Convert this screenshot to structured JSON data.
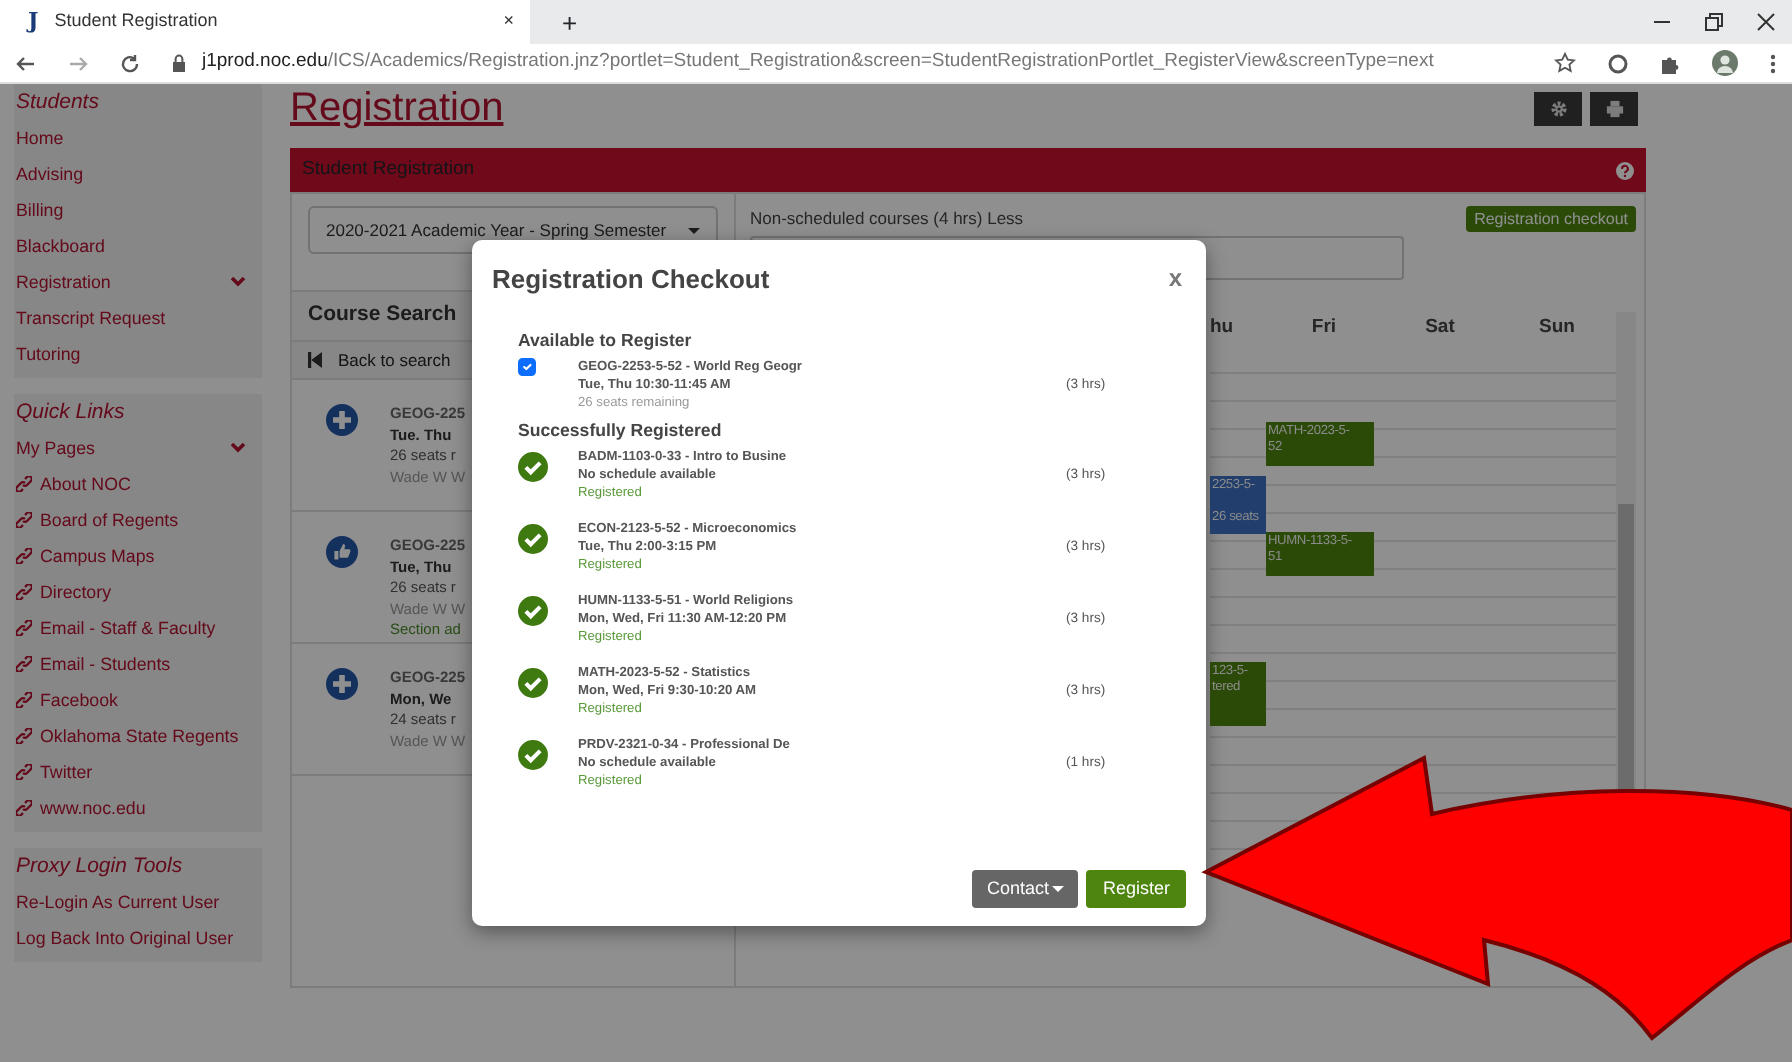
{
  "browser": {
    "tab": {
      "favicon": "J",
      "title": "Student Registration",
      "close": "×"
    },
    "new_tab": "+",
    "address": {
      "host": "j1prod.noc.edu",
      "path": "/ICS/Academics/Registration.jnz?portlet=Student_Registration&screen=StudentRegistrationPortlet_RegisterView&screenType=next"
    }
  },
  "sidebar": [
    {
      "title": "Students",
      "items": [
        {
          "label": "Home",
          "kind": "plain"
        },
        {
          "label": "Advising",
          "kind": "plain"
        },
        {
          "label": "Billing",
          "kind": "plain"
        },
        {
          "label": "Blackboard",
          "kind": "plain"
        },
        {
          "label": "Registration",
          "kind": "menu"
        },
        {
          "label": "Transcript Request",
          "kind": "plain"
        },
        {
          "label": "Tutoring",
          "kind": "plain"
        }
      ]
    },
    {
      "title": "Quick Links",
      "items": [
        {
          "label": "My Pages",
          "kind": "menu"
        },
        {
          "label": "About NOC",
          "kind": "link"
        },
        {
          "label": "Board of Regents",
          "kind": "link"
        },
        {
          "label": "Campus Maps",
          "kind": "link"
        },
        {
          "label": "Directory",
          "kind": "link"
        },
        {
          "label": "Email - Staff & Faculty",
          "kind": "link"
        },
        {
          "label": "Email - Students",
          "kind": "link"
        },
        {
          "label": "Facebook",
          "kind": "link"
        },
        {
          "label": "Oklahoma State Regents",
          "kind": "link"
        },
        {
          "label": "Twitter",
          "kind": "link"
        },
        {
          "label": "www.noc.edu",
          "kind": "link"
        }
      ]
    },
    {
      "title": "Proxy Login Tools",
      "items": [
        {
          "label": "Re-Login As Current User",
          "kind": "plain"
        },
        {
          "label": "Log Back Into Original User",
          "kind": "plain"
        }
      ]
    }
  ],
  "page": {
    "heading": "Registration",
    "portlet_title": "Student Registration",
    "term_select": "2020-2021 Academic Year - Spring Semester",
    "course_search": {
      "title": "Course Search",
      "back_link": "Back to search",
      "courses": [
        {
          "kind": "add",
          "code": "GEOG-225",
          "schedule": "Tue. Thu",
          "seats": "26 seats r",
          "instructor": "Wade W W"
        },
        {
          "kind": "added",
          "code": "GEOG-225",
          "schedule": "Tue, Thu",
          "seats": "26 seats r",
          "instructor": "Wade W W",
          "status": "Section ad"
        },
        {
          "kind": "add",
          "code": "GEOG-225",
          "schedule": "Mon, We",
          "seats": "24 seats r",
          "instructor": "Wade W W"
        }
      ]
    },
    "non_scheduled": {
      "label": "Non-scheduled courses (4 hrs)",
      "toggle": "Less"
    },
    "checkout_button": "Registration checkout",
    "calendar": {
      "days": [
        "hu",
        "Fri",
        "Sat",
        "Sun"
      ],
      "events": [
        {
          "lines": [
            "MATH-2023-5-",
            "52"
          ],
          "color": "#2b4a08"
        },
        {
          "lines": [
            "2253-5-",
            "26 seats"
          ],
          "color": "#213e6c"
        },
        {
          "lines": [
            "HUMN-1133-5-",
            "51"
          ],
          "color": "#2b4a08"
        },
        {
          "lines": [
            "123-5-",
            "tered"
          ],
          "color": "#2b4a08"
        }
      ]
    }
  },
  "modal": {
    "title": "Registration Checkout",
    "close": "x",
    "sections": [
      {
        "title": "Available to Register",
        "items": [
          {
            "kind": "checkbox",
            "checked": true,
            "course": "GEOG-2253-5-52 - World Reg Geogr",
            "schedule": "Tue, Thu 10:30-11:45 AM",
            "note": "26 seats remaining",
            "hours": "(3 hrs)"
          }
        ]
      },
      {
        "title": "Successfully Registered",
        "items": [
          {
            "kind": "registered",
            "course": "BADM-1103-0-33 - Intro to Busine",
            "schedule": "No schedule available",
            "note": "Registered",
            "hours": "(3 hrs)"
          },
          {
            "kind": "registered",
            "course": "ECON-2123-5-52 - Microeconomics",
            "schedule": "Tue, Thu 2:00-3:15 PM",
            "note": "Registered",
            "hours": "(3 hrs)"
          },
          {
            "kind": "registered",
            "course": "HUMN-1133-5-51 - World Religions",
            "schedule": "Mon, Wed, Fri 11:30 AM-12:20 PM",
            "note": "Registered",
            "hours": "(3 hrs)"
          },
          {
            "kind": "registered",
            "course": "MATH-2023-5-52 - Statistics",
            "schedule": "Mon, Wed, Fri 9:30-10:20 AM",
            "note": "Registered",
            "hours": "(3 hrs)"
          },
          {
            "kind": "registered",
            "course": "PRDV-2321-0-34 - Professional De",
            "schedule": "No schedule available",
            "note": "Registered",
            "hours": "(1 hrs)"
          }
        ]
      }
    ],
    "buttons": [
      {
        "label": "Contact",
        "kind": "dropdown"
      },
      {
        "label": "Register",
        "kind": "primary"
      }
    ]
  }
}
